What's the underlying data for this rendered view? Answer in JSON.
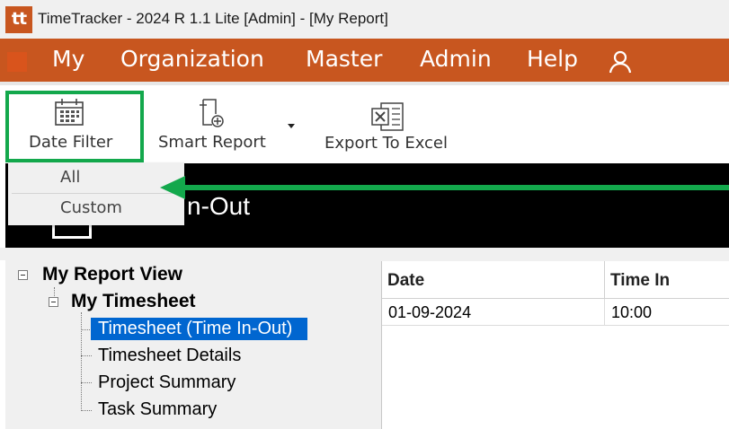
{
  "titlebar": {
    "logo": "tt",
    "title": "TimeTracker - 2024 R 1.1 Lite [Admin] - [My Report]"
  },
  "menu": {
    "items": [
      "My",
      "Organization",
      "Master",
      "Admin",
      "Help"
    ],
    "user_icon": "user-icon"
  },
  "toolbar": {
    "date_filter": "Date Filter",
    "smart_report": "Smart Report",
    "export_excel": "Export To Excel"
  },
  "dropdown": {
    "items": [
      "All",
      "Custom"
    ]
  },
  "banner": {
    "title": "n-Out"
  },
  "tree": {
    "root": "My Report View",
    "group": "My Timesheet",
    "items": [
      "Timesheet (Time In-Out)",
      "Timesheet Details",
      "Project Summary",
      "Task Summary"
    ],
    "selected_index": 0
  },
  "grid": {
    "columns": [
      "Date",
      "Time In"
    ],
    "rows": [
      [
        "01-09-2024",
        "10:00"
      ]
    ]
  },
  "colors": {
    "brand": "#c8561f",
    "highlight": "#13a84c",
    "selection": "#0066d0"
  }
}
